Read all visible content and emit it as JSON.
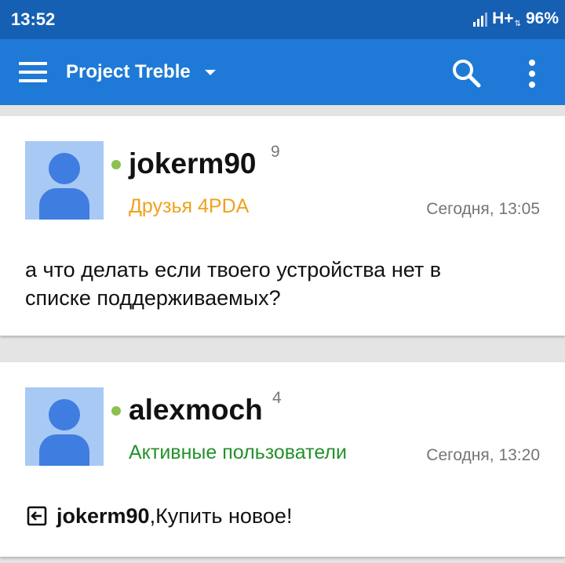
{
  "status_bar": {
    "time": "13:52",
    "network": "H+",
    "network_arrows": "⇅",
    "battery": "96%",
    "icons": [
      "signal-icon"
    ]
  },
  "app_bar": {
    "title": "Project Treble",
    "icons": [
      "menu-icon",
      "chevron-down-icon",
      "search-icon",
      "more-vert-icon"
    ]
  },
  "colors": {
    "status_bar_bg": "#1660b3",
    "app_bar_bg": "#1e7ad6",
    "friends_group": "#f0a11d",
    "active_group": "#23912b",
    "online": "#8cc04f",
    "avatar_bg": "#a9c9f5",
    "avatar_fg": "#3f7de0"
  },
  "posts": [
    {
      "username": "jokerm90",
      "reputation": "9",
      "group": "Друзья 4PDA",
      "date": "Сегодня, 13:05",
      "message_line1": "а что делать если твоего устройства нет в",
      "message_line2": "списке поддерживаемых?"
    },
    {
      "username": "alexmoch",
      "reputation": "4",
      "group": "Активные пользователи",
      "date": "Сегодня, 13:20",
      "reply_to": "jokerm90",
      "message": ",Купить новое!"
    }
  ]
}
